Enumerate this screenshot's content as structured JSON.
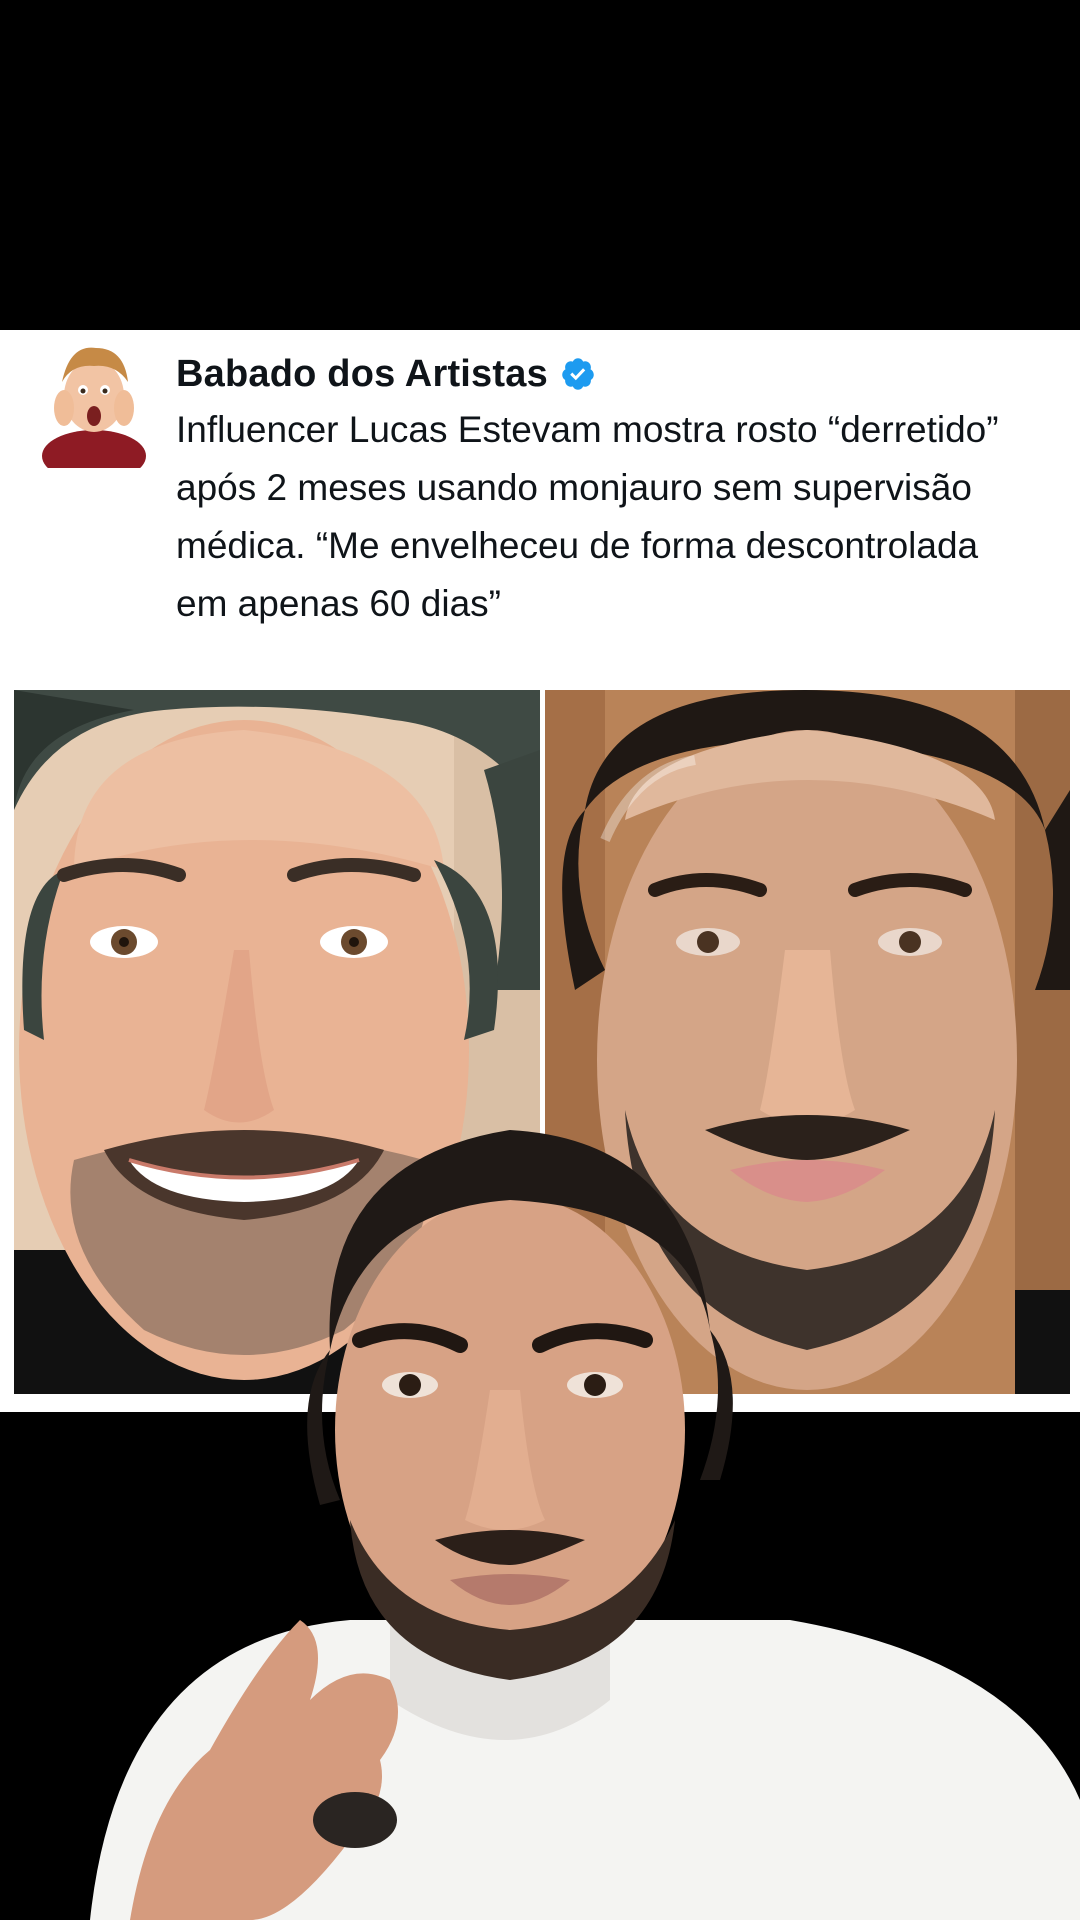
{
  "post": {
    "author_name": "Babado dos Artistas",
    "verified": true,
    "text": "Influencer Lucas Estevam mostra rosto “derretido” após 2 meses usando monjauro sem supervisão médica. “Me envelheceu de forma descontrolada em apenas 60 dias”"
  },
  "icons": {
    "verified": "verified-badge-icon",
    "avatar": "profile-avatar"
  },
  "colors": {
    "background": "#000000",
    "card": "#ffffff",
    "text": "#0f1419",
    "verified_blue": "#1d9bf0"
  }
}
